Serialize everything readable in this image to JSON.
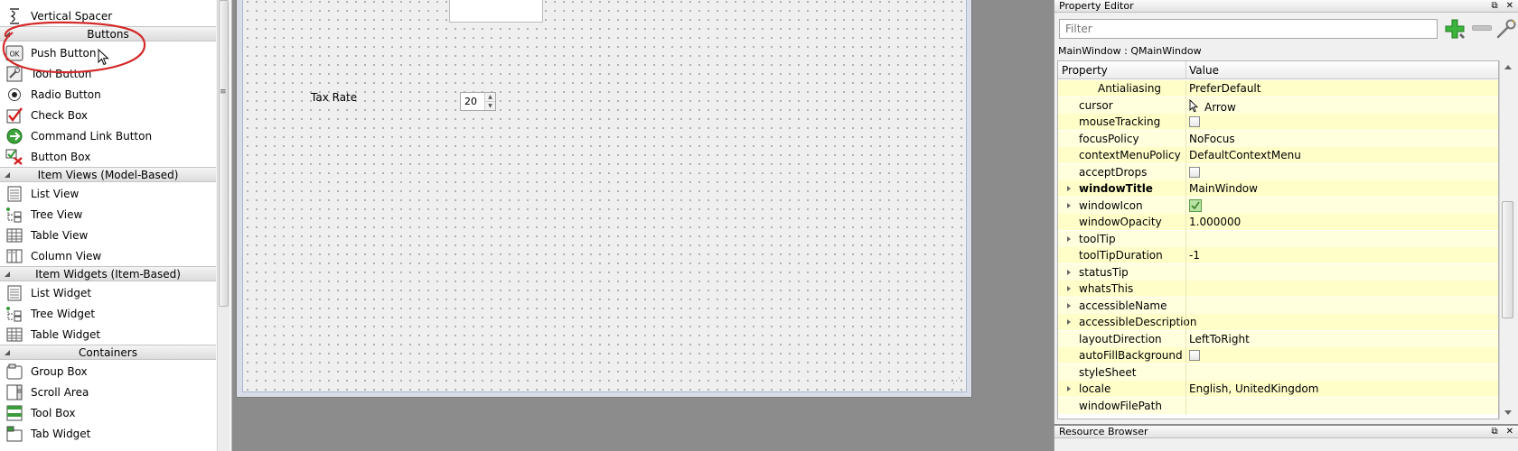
{
  "widget_box": {
    "items": [
      {
        "type": "item",
        "label": "Vertical Spacer",
        "icon": "vertical-spacer-icon"
      },
      {
        "type": "category",
        "label": "Buttons"
      },
      {
        "type": "item",
        "label": "Push Button",
        "icon": "push-button-icon",
        "icon_text": "OK"
      },
      {
        "type": "item",
        "label": "Tool Button",
        "icon": "tool-button-icon"
      },
      {
        "type": "item",
        "label": "Radio Button",
        "icon": "radio-button-icon"
      },
      {
        "type": "item",
        "label": "Check Box",
        "icon": "check-box-icon"
      },
      {
        "type": "item",
        "label": "Command Link Button",
        "icon": "command-link-icon"
      },
      {
        "type": "item",
        "label": "Button Box",
        "icon": "button-box-icon"
      },
      {
        "type": "category",
        "label": "Item Views (Model-Based)"
      },
      {
        "type": "item",
        "label": "List View",
        "icon": "list-view-icon"
      },
      {
        "type": "item",
        "label": "Tree View",
        "icon": "tree-view-icon"
      },
      {
        "type": "item",
        "label": "Table View",
        "icon": "table-view-icon"
      },
      {
        "type": "item",
        "label": "Column View",
        "icon": "column-view-icon"
      },
      {
        "type": "category",
        "label": "Item Widgets (Item-Based)"
      },
      {
        "type": "item",
        "label": "List Widget",
        "icon": "list-widget-icon"
      },
      {
        "type": "item",
        "label": "Tree Widget",
        "icon": "tree-widget-icon"
      },
      {
        "type": "item",
        "label": "Table Widget",
        "icon": "table-widget-icon"
      },
      {
        "type": "category",
        "label": "Containers"
      },
      {
        "type": "item",
        "label": "Group Box",
        "icon": "group-box-icon"
      },
      {
        "type": "item",
        "label": "Scroll Area",
        "icon": "scroll-area-icon"
      },
      {
        "type": "item",
        "label": "Tool Box",
        "icon": "tool-box-icon"
      },
      {
        "type": "item",
        "label": "Tab Widget",
        "icon": "tab-widget-icon"
      }
    ],
    "annotation_color": "#d42a2a"
  },
  "form": {
    "tax_label": "Tax Rate",
    "tax_value": "20"
  },
  "property_editor": {
    "title": "Property Editor",
    "filter_placeholder": "Filter",
    "object_class": "MainWindow : QMainWindow",
    "headers": {
      "property": "Property",
      "value": "Value"
    },
    "rows": [
      {
        "name": "Antialiasing",
        "value": "PreferDefault",
        "sub": true
      },
      {
        "name": "cursor",
        "value": "Arrow",
        "value_icon": "arrow-cursor-icon"
      },
      {
        "name": "mouseTracking",
        "checkbox": true
      },
      {
        "name": "focusPolicy",
        "value": "NoFocus"
      },
      {
        "name": "contextMenuPolicy",
        "value": "DefaultContextMenu"
      },
      {
        "name": "acceptDrops",
        "checkbox": true
      },
      {
        "name": "windowTitle",
        "value": "MainWindow",
        "expandable": true,
        "bold": true
      },
      {
        "name": "windowIcon",
        "expandable": true,
        "value_icon": "window-icon-preview"
      },
      {
        "name": "windowOpacity",
        "value": "1.000000"
      },
      {
        "name": "toolTip",
        "expandable": true
      },
      {
        "name": "toolTipDuration",
        "value": "-1"
      },
      {
        "name": "statusTip",
        "expandable": true
      },
      {
        "name": "whatsThis",
        "expandable": true
      },
      {
        "name": "accessibleName",
        "expandable": true
      },
      {
        "name": "accessibleDescription",
        "expandable": true
      },
      {
        "name": "layoutDirection",
        "value": "LeftToRight"
      },
      {
        "name": "autoFillBackground",
        "checkbox": true
      },
      {
        "name": "styleSheet"
      },
      {
        "name": "locale",
        "value": "English, UnitedKingdom",
        "expandable": true
      },
      {
        "name": "windowFilePath"
      }
    ],
    "row_color": "#fffec9"
  },
  "resource_browser": {
    "title": "Resource Browser"
  }
}
